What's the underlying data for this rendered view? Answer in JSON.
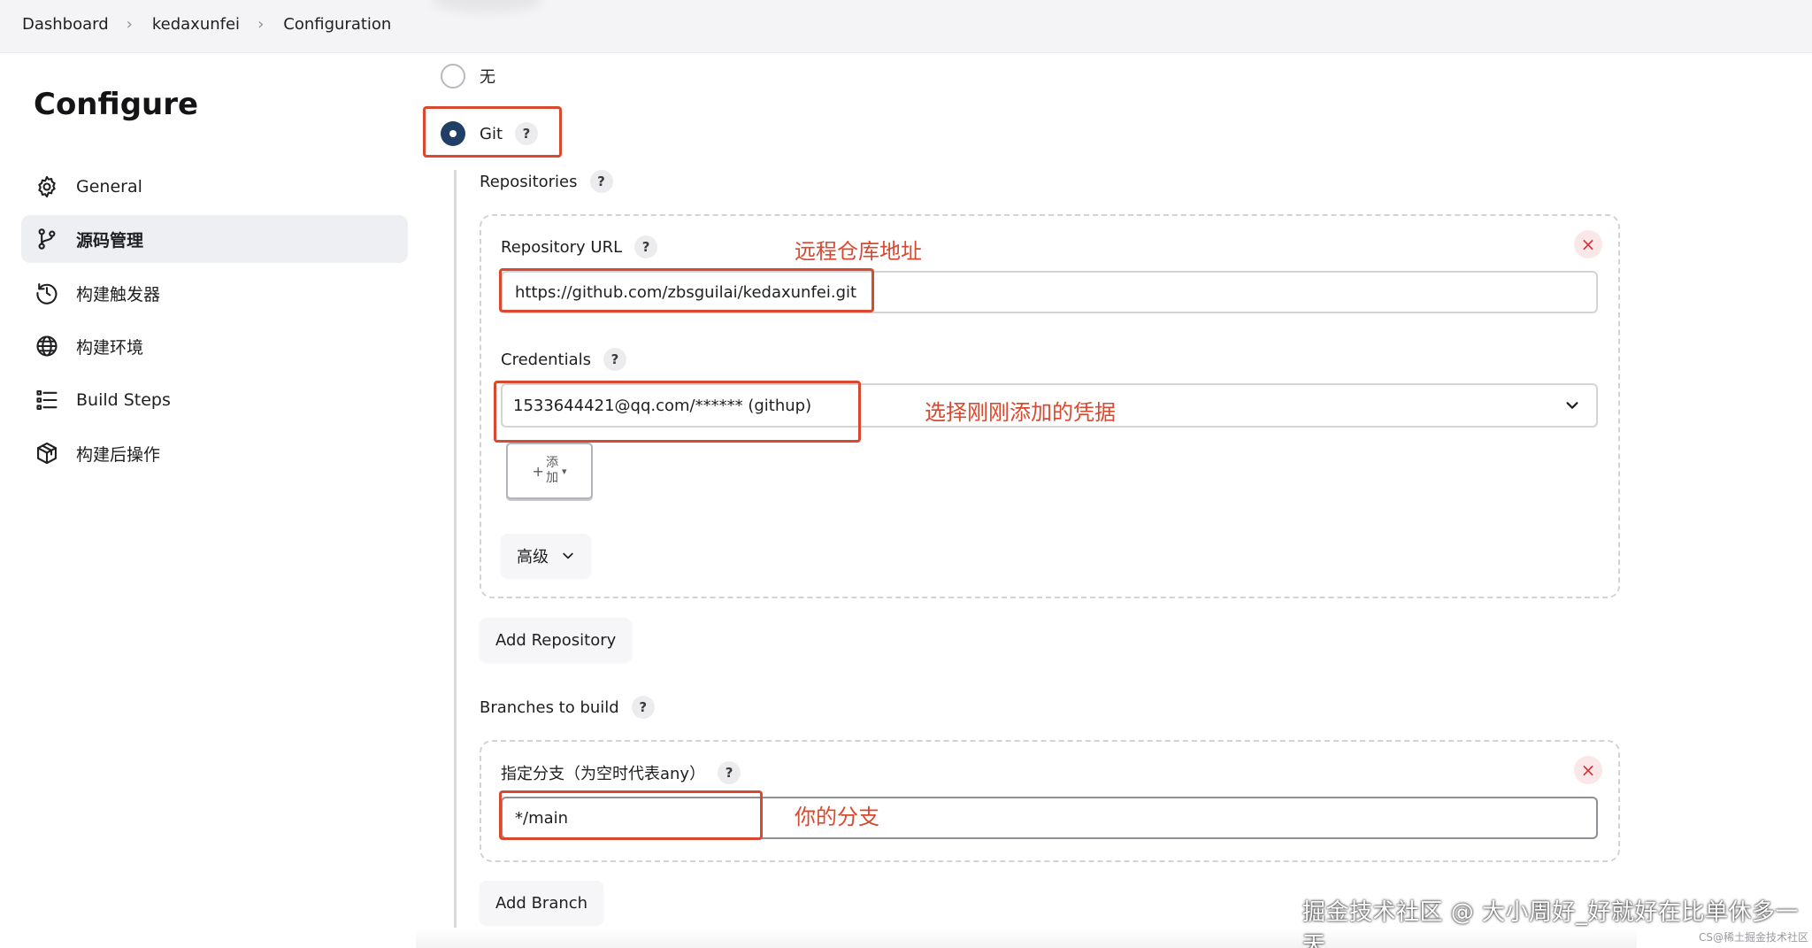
{
  "breadcrumb": [
    "Dashboard",
    "kedaxunfei",
    "Configuration"
  ],
  "sidebar": {
    "title": "Configure",
    "items": [
      {
        "label": "General",
        "icon": "gear-icon"
      },
      {
        "label": "源码管理",
        "icon": "branch-icon"
      },
      {
        "label": "构建触发器",
        "icon": "clock-icon"
      },
      {
        "label": "构建环境",
        "icon": "globe-icon"
      },
      {
        "label": "Build Steps",
        "icon": "list-icon"
      },
      {
        "label": "构建后操作",
        "icon": "package-icon"
      }
    ],
    "active_index": 1
  },
  "scm": {
    "options": [
      {
        "label": "无",
        "checked": false
      },
      {
        "label": "Git",
        "checked": true
      }
    ],
    "repositories_label": "Repositories",
    "repository": {
      "url_label": "Repository URL",
      "url_value": "https://github.com/zbsguilai/kedaxunfei.git",
      "credentials_label": "Credentials",
      "credentials_value": "1533644421@qq.com/****** (githup)",
      "add_button": {
        "plus": "+",
        "line1": "添",
        "line2": "加"
      },
      "advanced_label": "高级"
    },
    "add_repository_label": "Add Repository",
    "branches_label": "Branches to build",
    "branch": {
      "spec_label": "指定分支（为空时代表any）",
      "spec_value": "*/main"
    },
    "add_branch_label": "Add Branch"
  },
  "help_symbol": "?",
  "close_symbol": "×",
  "annotations": {
    "repo_url": "远程仓库地址",
    "credentials": "选择刚刚添加的凭据",
    "branch": "你的分支"
  },
  "watermark": "掘金技术社区 @ 大小周好_好就好在比单休多一天",
  "watermark_small": "CS@稀土掘金技术社区",
  "colors": {
    "annotation_red": "#d9492f",
    "radio_checked": "#1f3f66",
    "close_red": "#d5333b"
  }
}
